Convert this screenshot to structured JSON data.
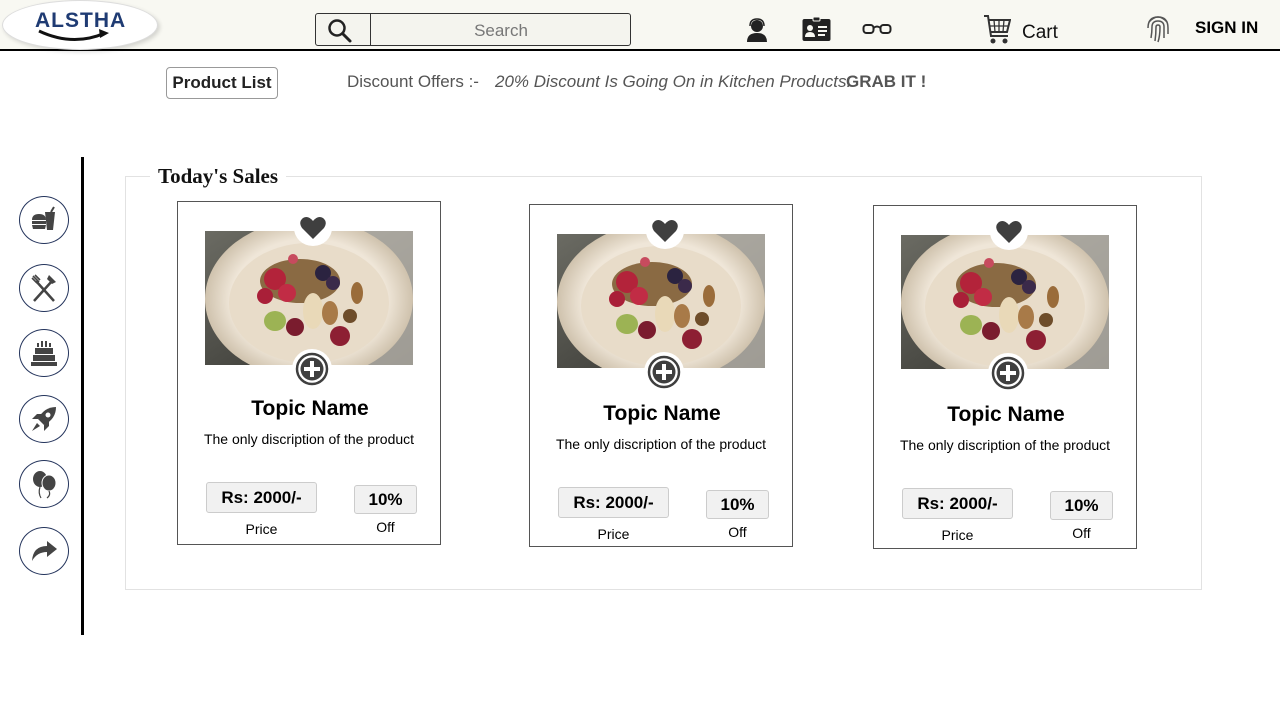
{
  "header": {
    "logo_text": "ALSTHA",
    "search_placeholder": "Search",
    "nav_icons": [
      "support-agent-icon",
      "contact-card-icon",
      "glasses-icon"
    ],
    "cart_label": "Cart",
    "signin_label": "SIGN IN"
  },
  "toolbar": {
    "product_list_label": "Product List",
    "discount_label": "Discount Offers :-",
    "discount_text": "20% Discount Is Going On in Kitchen Products.",
    "discount_cta": "GRAB IT !"
  },
  "sidebar": {
    "items": [
      {
        "icon": "fast-food-icon"
      },
      {
        "icon": "fork-knife-icon"
      },
      {
        "icon": "cake-icon"
      },
      {
        "icon": "rocket-icon"
      },
      {
        "icon": "balloons-icon"
      },
      {
        "icon": "share-arrow-icon"
      }
    ]
  },
  "sales": {
    "title": "Today's Sales",
    "products": [
      {
        "name": "Topic Name",
        "description": "The only discription of the product",
        "price": "Rs: 2000/-",
        "price_label": "Price",
        "discount": "10%",
        "discount_label": "Off"
      },
      {
        "name": "Topic Name",
        "description": "The only discription of the product",
        "price": "Rs: 2000/-",
        "price_label": "Price",
        "discount": "10%",
        "discount_label": "Off"
      },
      {
        "name": "Topic Name",
        "description": "The only discription of the product",
        "price": "Rs: 2000/-",
        "price_label": "Price",
        "discount": "10%",
        "discount_label": "Off"
      }
    ]
  },
  "colors": {
    "header_bg": "#f8f8f2",
    "logo_blue": "#1f3b73",
    "sidebar_border": "#24345c",
    "icon_dark": "#444444"
  }
}
